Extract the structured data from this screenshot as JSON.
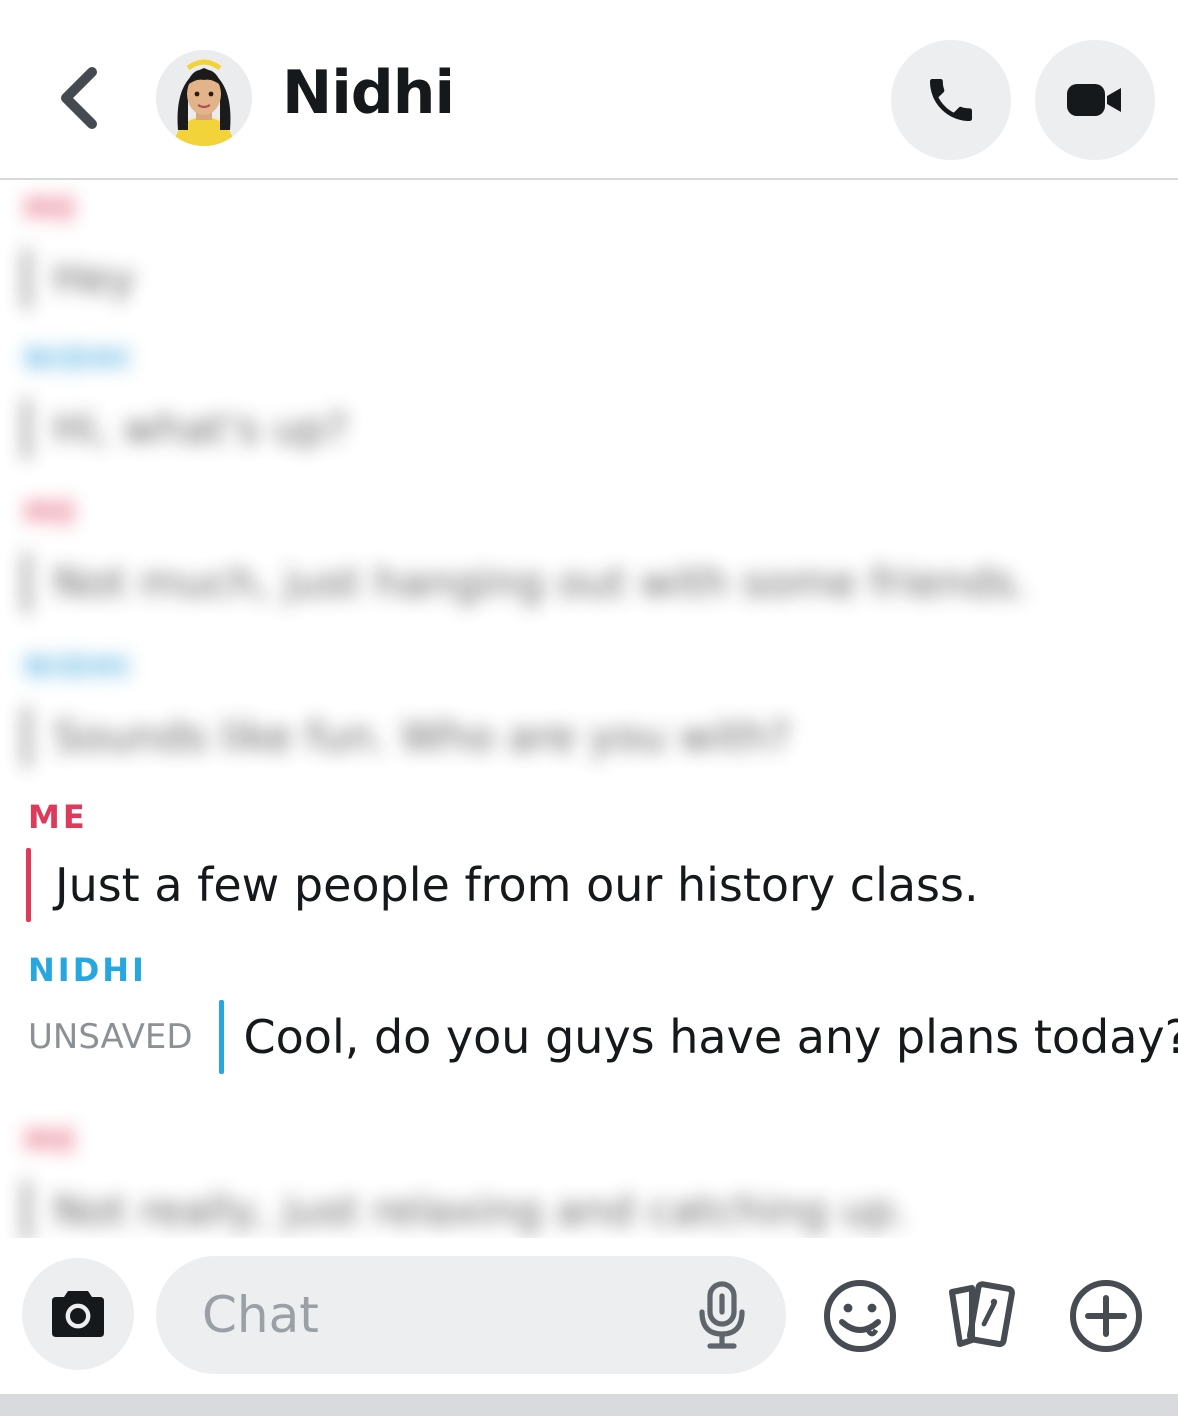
{
  "header": {
    "contact_name": "Nidhi",
    "back_icon": "chevron-left-icon",
    "call_icon": "phone-icon",
    "video_icon": "video-camera-icon"
  },
  "messages": {
    "blurred_history": [
      {
        "sender": "ME",
        "text": "Hey"
      },
      {
        "sender": "NIDHI",
        "text": "Hi, what's up?"
      },
      {
        "sender": "ME",
        "text": "Not much, just hanging out with some friends."
      },
      {
        "sender": "NIDHI",
        "text": "Sounds like fun. Who are you with?"
      },
      {
        "sender": "ME",
        "text": "Not really, just relaxing and catching up."
      }
    ],
    "me": {
      "sender": "ME",
      "text": "Just a few people from our history class."
    },
    "nidhi": {
      "sender": "NIDHI",
      "status": "UNSAVED",
      "text": "Cool, do you guys have any plans today?"
    }
  },
  "composer": {
    "placeholder": "Chat",
    "camera_icon": "camera-icon",
    "mic_icon": "microphone-icon",
    "emoji_icon": "emoji-icon",
    "cards_icon": "cards-icon",
    "plus_icon": "plus-icon"
  },
  "colors": {
    "me_accent": "#de3a5a",
    "friend_accent": "#26a7e0",
    "button_bg": "#eceef0"
  }
}
